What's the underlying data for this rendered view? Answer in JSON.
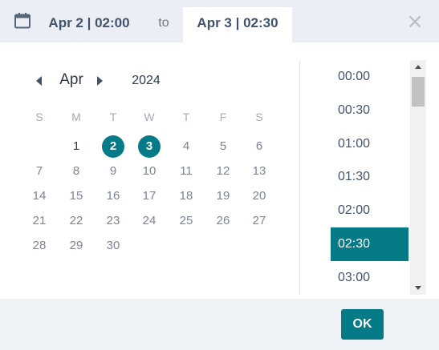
{
  "header": {
    "range_start": "Apr 2 | 02:00",
    "range_separator": "to",
    "range_end": "Apr 3 | 02:30"
  },
  "calendar": {
    "month": "Apr",
    "year": "2024",
    "weekdays": [
      "S",
      "M",
      "T",
      "W",
      "T",
      "F",
      "S"
    ],
    "days": [
      "1",
      "2",
      "3",
      "4",
      "5",
      "6",
      "7",
      "8",
      "9",
      "10",
      "11",
      "12",
      "13",
      "14",
      "15",
      "16",
      "17",
      "18",
      "19",
      "20",
      "21",
      "22",
      "23",
      "24",
      "25",
      "26",
      "27",
      "28",
      "29",
      "30"
    ],
    "selected_days": [
      "2",
      "3"
    ]
  },
  "times": [
    "00:00",
    "00:30",
    "01:00",
    "01:30",
    "02:00",
    "02:30",
    "03:00"
  ],
  "selected_time": "02:30",
  "footer": {
    "ok_label": "OK"
  },
  "colors": {
    "accent": "#047b87",
    "header_bg": "#ebeef4",
    "footer_bg": "#eef1f6"
  }
}
